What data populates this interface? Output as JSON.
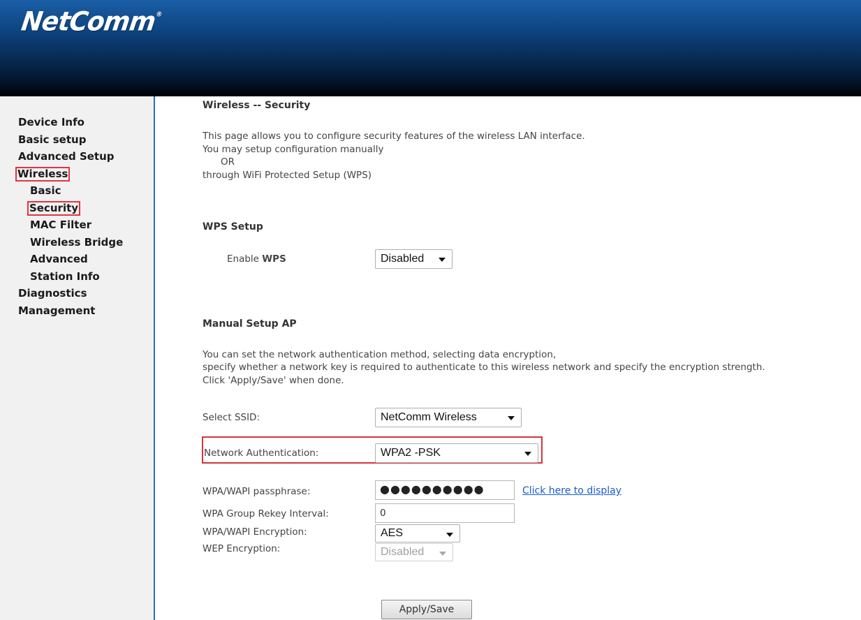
{
  "header": {
    "logo_text": "NetComm",
    "logo_mark": "®"
  },
  "sidebar": {
    "items": [
      {
        "label": "Device Info",
        "sub": false,
        "highlighted": false
      },
      {
        "label": "Basic setup",
        "sub": false,
        "highlighted": false
      },
      {
        "label": "Advanced Setup",
        "sub": false,
        "highlighted": false
      },
      {
        "label": "Wireless",
        "sub": false,
        "highlighted": true
      },
      {
        "label": "Basic",
        "sub": true,
        "highlighted": false
      },
      {
        "label": "Security",
        "sub": true,
        "highlighted": true
      },
      {
        "label": "MAC Filter",
        "sub": true,
        "highlighted": false
      },
      {
        "label": "Wireless Bridge",
        "sub": true,
        "highlighted": false
      },
      {
        "label": "Advanced",
        "sub": true,
        "highlighted": false
      },
      {
        "label": "Station Info",
        "sub": true,
        "highlighted": false
      },
      {
        "label": "Diagnostics",
        "sub": false,
        "highlighted": false
      },
      {
        "label": "Management",
        "sub": false,
        "highlighted": false
      }
    ]
  },
  "page": {
    "title": "Wireless -- Security",
    "intro": {
      "line1": "This page allows you to configure security features of the wireless LAN interface.",
      "line2": "You may setup configuration manually",
      "line3": "OR",
      "line4": "through WiFi Protected Setup (WPS)"
    }
  },
  "wps": {
    "heading": "WPS Setup",
    "enable_label_prefix": "Enable",
    "enable_label_bold": "WPS",
    "value": "Disabled"
  },
  "manual": {
    "heading": "Manual Setup AP",
    "desc1": "You can set the network authentication method, selecting data encryption,",
    "desc2": "specify whether a network key is required to authenticate to this wireless network and specify the encryption strength.",
    "desc3": "Click 'Apply/Save' when done.",
    "ssid_label": "Select SSID:",
    "ssid_value": "NetComm Wireless",
    "auth_label": "Network Authentication:",
    "auth_value": "WPA2 -PSK",
    "passphrase_label": "WPA/WAPI passphrase:",
    "passphrase_value": "●●●●●●●●●●",
    "display_link": "Click here to display",
    "rekey_label": "WPA Group Rekey Interval:",
    "rekey_value": "0",
    "encryption_label": "WPA/WAPI Encryption:",
    "encryption_value": "AES",
    "wep_label": "WEP Encryption:",
    "wep_value": "Disabled",
    "apply_label": "Apply/Save"
  },
  "colors": {
    "header_top": "#1a5ea6",
    "header_bottom": "#000000",
    "sidebar_border": "#2c6cb3",
    "highlight": "#d8323d",
    "link": "#1a5ccf"
  }
}
